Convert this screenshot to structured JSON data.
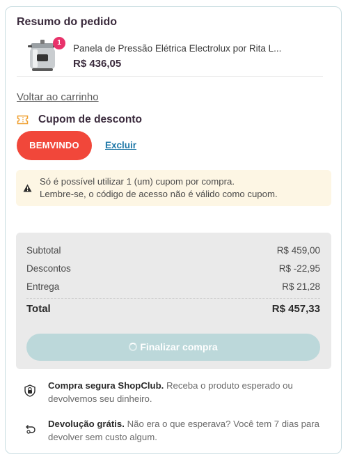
{
  "order_summary": {
    "title": "Resumo do pedido",
    "product": {
      "quantity_badge": "1",
      "name": "Panela de Pressão Elétrica Electrolux por Rita L...",
      "price": "R$ 436,05"
    },
    "back_link": "Voltar ao carrinho"
  },
  "coupon": {
    "title": "Cupom de desconto",
    "code": "BEMVINDO",
    "remove_label": "Excluir",
    "notice_line1": "Só é possível utilizar 1 (um) cupom por compra.",
    "notice_line2": "Lembre-se, o código de acesso não é válido como cupom."
  },
  "totals": {
    "subtotal_label": "Subtotal",
    "subtotal_value": "R$ 459,00",
    "discount_label": "Descontos",
    "discount_value": "R$ -22,95",
    "shipping_label": "Entrega",
    "shipping_value": "R$ 21,28",
    "total_label": "Total",
    "total_value": "R$ 457,33"
  },
  "checkout_button": "Finalizar compra",
  "guarantees": {
    "secure_title": "Compra segura ShopClub.",
    "secure_text": " Receba o produto esperado ou devolvemos seu dinheiro.",
    "return_title": "Devolução grátis.",
    "return_text": " Não era o que esperava? Você tem 7 dias para devolver sem custo algum."
  },
  "colors": {
    "coupon_accent": "#f1473a",
    "link": "#2179a8",
    "badge": "#e8326a",
    "button_disabled": "#bcd8da"
  }
}
